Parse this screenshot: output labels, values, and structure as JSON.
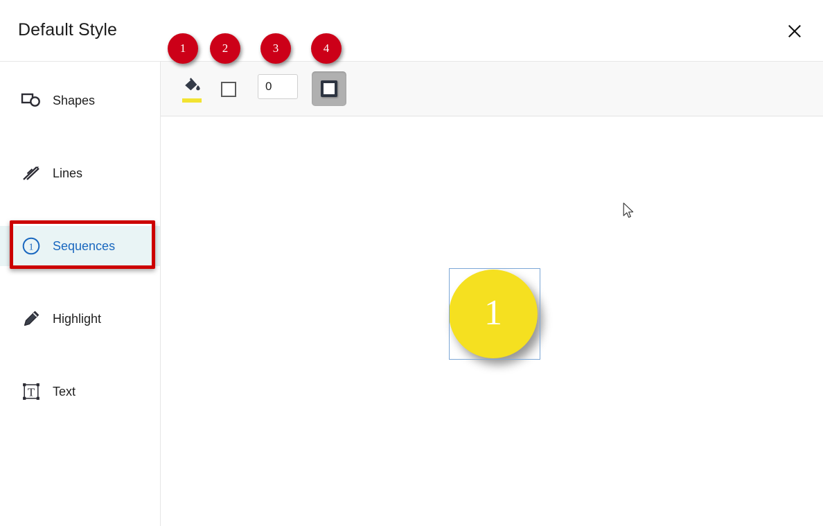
{
  "window": {
    "title": "Default Style",
    "close_label": "×",
    "close_icon": "close-icon"
  },
  "sidebar": {
    "items": [
      {
        "label": "Shapes",
        "icon": "shapes-icon",
        "selected": false
      },
      {
        "label": "Lines",
        "icon": "lines-icon",
        "selected": false
      },
      {
        "label": "Sequences",
        "icon": "sequence-number-icon",
        "selected": true
      },
      {
        "label": "Highlight",
        "icon": "pen-highlight-icon",
        "selected": false
      },
      {
        "label": "Text",
        "icon": "text-box-icon",
        "selected": false
      }
    ],
    "selected_bg": "#e9f4f5",
    "selected_text_color": "#1967bf"
  },
  "toolbar": {
    "fill_color_tool": {
      "name": "fill-color",
      "icon": "paint-bucket-icon",
      "swatch_color": "#f2e332"
    },
    "border_color_tool": {
      "name": "border-color",
      "icon": "square-swatch-icon",
      "swatch_color": "#ffffff"
    },
    "number_field": {
      "name": "border-width",
      "value": "0",
      "placeholder": "0"
    },
    "shape_style_button": {
      "name": "shape-style",
      "icon": "filled-square-icon",
      "pressed": true
    }
  },
  "badges": [
    {
      "label": "1",
      "target": "fill-color-tool"
    },
    {
      "label": "2",
      "target": "border-color-tool"
    },
    {
      "label": "3",
      "target": "number-field"
    },
    {
      "label": "4",
      "target": "shape-style-button"
    }
  ],
  "badge_color": "#cc0018",
  "annotation": {
    "box_color": "#cc0000",
    "target": "sidebar-item-sequences"
  },
  "canvas": {
    "sequence_object": {
      "number": "1",
      "fill_color": "#f5e020",
      "text_color": "#ffffff",
      "selected": true,
      "selection_border_color": "#7ba6d6"
    }
  },
  "cursor": {
    "icon": "arrow-cursor-icon"
  }
}
